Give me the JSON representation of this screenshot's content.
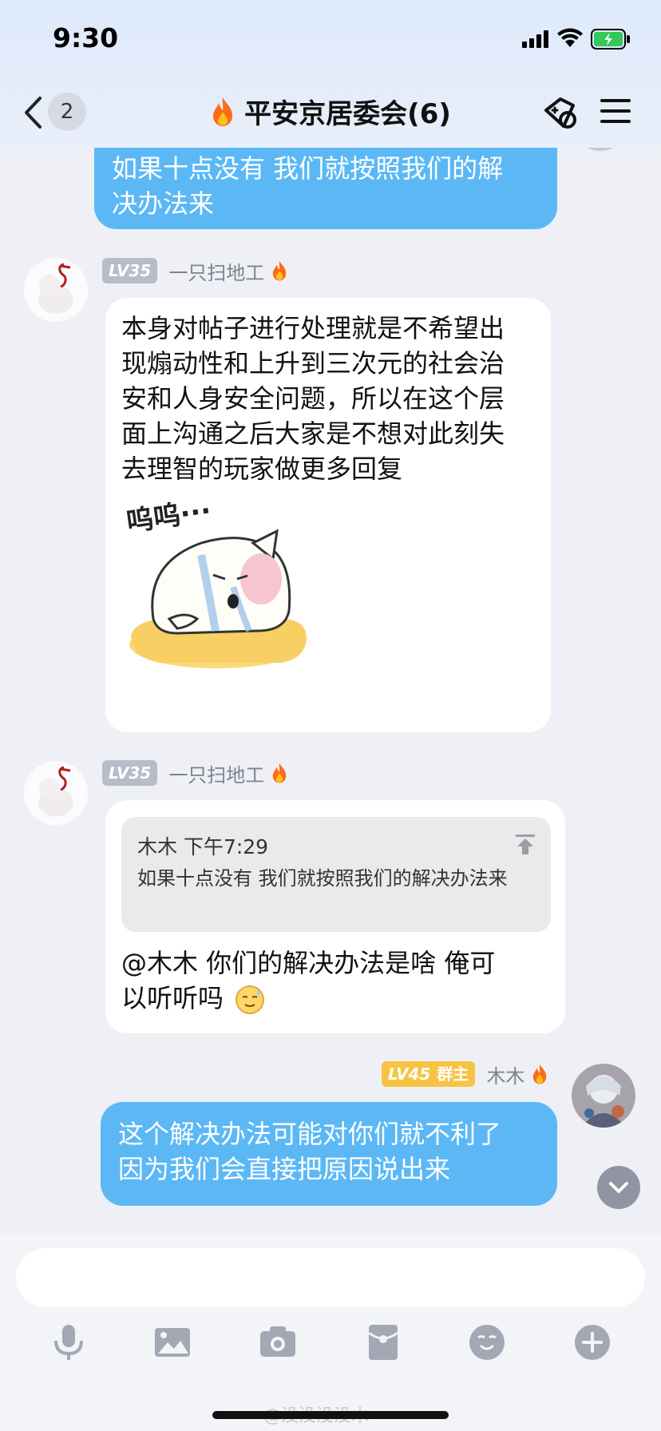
{
  "status_bar": {
    "time": "9:30"
  },
  "nav": {
    "unread_count": "2",
    "title": "平安京居委会(6)"
  },
  "messages": [
    {
      "lines": [
        "如果十点没有  我们就按照我们的解",
        "决办法来"
      ]
    },
    {
      "level": "LV35",
      "nickname": "一只扫地工",
      "lines": [
        "本身对帖子进行处理就是不希望出",
        "现煽动性和上升到三次元的社会治",
        "安和人身安全问题，所以在这个层",
        "面上沟通之后大家是不想对此刻失",
        "去理智的玩家做更多回复"
      ],
      "sticker_text": "呜呜···"
    },
    {
      "level": "LV35",
      "nickname": "一只扫地工",
      "quote": {
        "author_time": "木木 下午7:29",
        "text": "如果十点没有  我们就按照我们的解决办法来"
      },
      "lines": [
        "@木木  你们的解决办法是啥    俺可",
        "以听听吗"
      ]
    },
    {
      "level": "LV45",
      "role": "群主",
      "nickname": "木木",
      "lines": [
        "这个解决办法可能对你们就不利了",
        "因为我们会直接把原因说出来"
      ]
    }
  ],
  "input": {
    "placeholder": ""
  },
  "toolbar_icons": [
    "microphone-icon",
    "image-icon",
    "camera-icon",
    "red-packet-icon",
    "emoji-icon",
    "plus-icon"
  ],
  "watermark": "@没没没没木",
  "colors": {
    "accent_blue": "#5cb8f5",
    "level_gray": "#b7bcc8",
    "owner_gold": "#f6c343",
    "background": "#eef0f5"
  }
}
